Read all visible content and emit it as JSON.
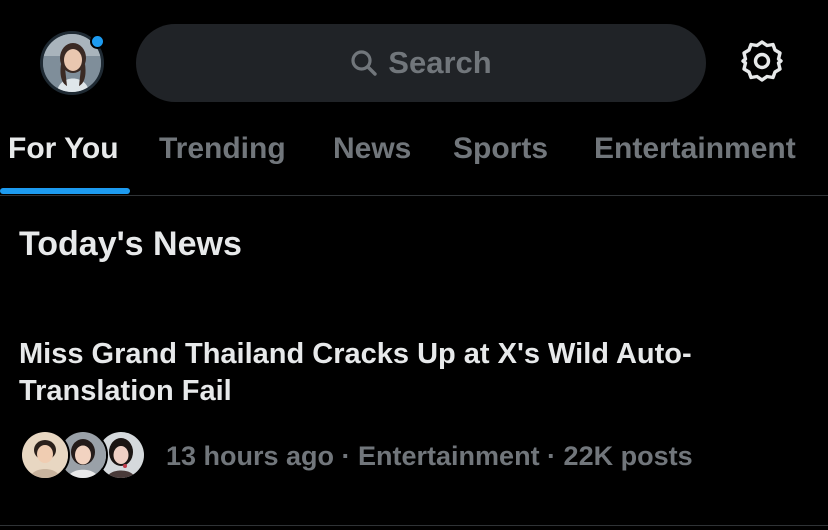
{
  "header": {
    "search_placeholder": "Search",
    "search_icon": "search-icon",
    "settings_icon": "gear-icon",
    "profile_status_color": "#1d9bf0"
  },
  "tabs": [
    {
      "label": "For You",
      "active": true
    },
    {
      "label": "Trending",
      "active": false
    },
    {
      "label": "News",
      "active": false
    },
    {
      "label": "Sports",
      "active": false
    },
    {
      "label": "Entertainment",
      "active": false
    }
  ],
  "section": {
    "title": "Today's News"
  },
  "news_items": [
    {
      "headline": "Miss Grand Thailand Cracks Up at X's Wild Auto-Translation Fail",
      "meta": "13 hours ago · Entertainment · 22K posts"
    }
  ],
  "colors": {
    "background": "#000000",
    "accent": "#1d9bf0",
    "primary_text": "#e7e9ea",
    "secondary_text": "#71767b",
    "search_fill": "#202327"
  }
}
